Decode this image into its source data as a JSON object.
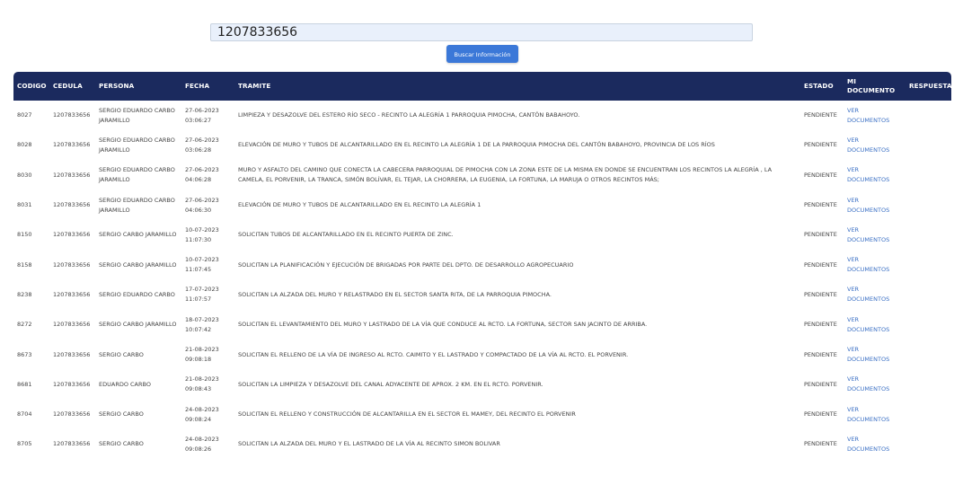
{
  "search": {
    "value": "1207833656"
  },
  "button": {
    "label": "Buscar Información"
  },
  "table": {
    "headers": {
      "codigo": "CODIGO",
      "cedula": "CEDULA",
      "persona": "PERSONA",
      "fecha": "FECHA",
      "tramite": "TRAMITE",
      "estado": "ESTADO",
      "documento": "MI DOCUMENTO",
      "respuesta": "RESPUESTA"
    },
    "rows": [
      {
        "codigo": "8027",
        "cedula": "1207833656",
        "persona": "SERGIO EDUARDO CARBO JARAMILLO",
        "fecha": "27-06-2023",
        "hora": "03:06:27",
        "tramite": "LIMPIEZA Y DESAZOLVE DEL ESTERO RÍO SECO - RECINTO LA ALEGRÍA 1 PARROQUIA PIMOCHA, CANTÓN BABAHOYO.",
        "estado": "PENDIENTE",
        "ver": "VER",
        "documentos": "DOCUMENTOS"
      },
      {
        "codigo": "8028",
        "cedula": "1207833656",
        "persona": "SERGIO EDUARDO CARBO JARAMILLO",
        "fecha": "27-06-2023",
        "hora": "03:06:28",
        "tramite": "ELEVACIÓN DE MURO Y TUBOS DE ALCANTARILLADO EN EL RECINTO LA ALEGRÍA 1 DE LA PARROQUIA PIMOCHA DEL CANTÓN BABAHOYO, PROVINCIA DE LOS RÍOS",
        "estado": "PENDIENTE",
        "ver": "VER",
        "documentos": "DOCUMENTOS"
      },
      {
        "codigo": "8030",
        "cedula": "1207833656",
        "persona": "SERGIO EDUARDO CARBO JARAMILLO",
        "fecha": "27-06-2023",
        "hora": "04:06:28",
        "tramite": "MURO Y ASFALTO DEL CAMINO QUE CONECTA LA CABECERA PARROQUIAL DE PIMOCHA CON LA ZONA ESTE DE LA MISMA EN DONDE SE ENCUENTRAN LOS RECINTOS LA ALEGRÍA , LA CAMELA, EL PORVENIR, LA TRANCA, SIMÓN BOLÍVAR, EL TEJAR, LA CHORRERA, LA EUGENIA, LA FORTUNA, LA MARUJA O OTROS RECINTOS MÁS;",
        "estado": "PENDIENTE",
        "ver": "VER",
        "documentos": "DOCUMENTOS"
      },
      {
        "codigo": "8031",
        "cedula": "1207833656",
        "persona": "SERGIO EDUARDO CARBO JARAMILLO",
        "fecha": "27-06-2023",
        "hora": "04:06:30",
        "tramite": "ELEVACIÓN DE MURO Y TUBOS DE ALCANTARILLADO EN EL RECINTO LA ALEGRÍA 1",
        "estado": "PENDIENTE",
        "ver": "VER",
        "documentos": "DOCUMENTOS"
      },
      {
        "codigo": "8150",
        "cedula": "1207833656",
        "persona": "SERGIO CARBO JARAMILLO",
        "fecha": "10-07-2023",
        "hora": "11:07:30",
        "tramite": "SOLICITAN TUBOS DE ALCANTARILLADO EN EL RECINTO PUERTA DE ZINC.",
        "estado": "PENDIENTE",
        "ver": "VER",
        "documentos": "DOCUMENTOS"
      },
      {
        "codigo": "8158",
        "cedula": "1207833656",
        "persona": "SERGIO CARBO JARAMILLO",
        "fecha": "10-07-2023",
        "hora": "11:07:45",
        "tramite": "SOLICITAN LA PLANIFICACIÓN Y EJECUCIÓN DE BRIGADAS POR PARTE DEL DPTO. DE DESARROLLO AGROPECUARIO",
        "estado": "PENDIENTE",
        "ver": "VER",
        "documentos": "DOCUMENTOS"
      },
      {
        "codigo": "8238",
        "cedula": "1207833656",
        "persona": "SERGIO EDUARDO CARBO",
        "fecha": "17-07-2023",
        "hora": "11:07:57",
        "tramite": "SOLICITAN LA ALZADA DEL MURO Y RELASTRADO EN EL SECTOR SANTA RITA, DE LA PARROQUIA PIMOCHA.",
        "estado": "PENDIENTE",
        "ver": "VER",
        "documentos": "DOCUMENTOS"
      },
      {
        "codigo": "8272",
        "cedula": "1207833656",
        "persona": "SERGIO CARBO JARAMILLO",
        "fecha": "18-07-2023",
        "hora": "10:07:42",
        "tramite": "SOLICITAN EL LEVANTAMIENTO DEL MURO Y LASTRADO DE LA VÍA QUE CONDUCE AL RCTO. LA FORTUNA, SECTOR SAN JACINTO DE ARRIBA.",
        "estado": "PENDIENTE",
        "ver": "VER",
        "documentos": "DOCUMENTOS"
      },
      {
        "codigo": "8673",
        "cedula": "1207833656",
        "persona": "SERGIO CARBO",
        "fecha": "21-08-2023",
        "hora": "09:08:18",
        "tramite": "SOLICITAN EL RELLENO DE LA VÍA DE INGRESO AL RCTO. CAIMITO Y EL LASTRADO Y COMPACTADO DE LA VÍA AL RCTO. EL PORVENIR.",
        "estado": "PENDIENTE",
        "ver": "VER",
        "documentos": "DOCUMENTOS"
      },
      {
        "codigo": "8681",
        "cedula": "1207833656",
        "persona": "EDUARDO CARBO",
        "fecha": "21-08-2023",
        "hora": "09:08:43",
        "tramite": "SOLICITAN LA LIMPIEZA Y DESAZOLVE DEL CANAL ADYACENTE DE APROX. 2 KM. EN EL RCTO. PORVENIR.",
        "estado": "PENDIENTE",
        "ver": "VER",
        "documentos": "DOCUMENTOS"
      },
      {
        "codigo": "8704",
        "cedula": "1207833656",
        "persona": "SERGIO CARBO",
        "fecha": "24-08-2023",
        "hora": "09:08:24",
        "tramite": "SOLICITAN EL RELLENO Y CONSTRUCCIÓN DE ALCANTARILLA EN EL SECTOR EL MAMEY, DEL RECINTO EL PORVENIR",
        "estado": "PENDIENTE",
        "ver": "VER",
        "documentos": "DOCUMENTOS"
      },
      {
        "codigo": "8705",
        "cedula": "1207833656",
        "persona": "SERGIO CARBO",
        "fecha": "24-08-2023",
        "hora": "09:08:26",
        "tramite": "SOLICITAN LA ALZADA DEL MURO Y EL LASTRADO DE LA VÍA AL RECINTO SIMON BOLIVAR",
        "estado": "PENDIENTE",
        "ver": "VER",
        "documentos": "DOCUMENTOS"
      }
    ]
  }
}
